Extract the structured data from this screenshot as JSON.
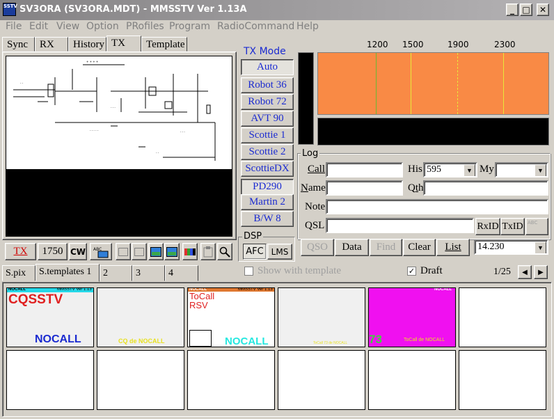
{
  "window": {
    "title": "SV3ORA (SV3ORA.MDT) - MMSSTV Ver 1.13A",
    "icon_text": "SSTV",
    "minimize": "_",
    "maximize": "□",
    "close": "✕"
  },
  "menu": [
    "File",
    "Edit",
    "View",
    "Option",
    "PRofiles",
    "Program",
    "RadioCommand",
    "Help"
  ],
  "tabs": [
    "Sync",
    "RX",
    "History",
    "TX",
    "Template"
  ],
  "active_tab": "TX",
  "tx_mode": {
    "label": "TX Mode",
    "modes": [
      "Auto",
      "Robot 36",
      "Robot 72",
      "AVT 90",
      "Scottie 1",
      "Scottie 2",
      "ScottieDX",
      "PD290",
      "Martin 2",
      "B/W 8"
    ],
    "selected": [
      "Auto",
      "PD290"
    ]
  },
  "spectrum": {
    "freq_labels": [
      "1200",
      "1500",
      "1900",
      "2300"
    ],
    "colors": {
      "background": "#f98a45",
      "sync": "#6bb834",
      "marker": "#e8e83a"
    }
  },
  "log": {
    "title": "Log",
    "call_label": "Call",
    "call_value": "",
    "his_label": "His",
    "his_value": "595",
    "my_label": "My",
    "my_value": "",
    "name_label": "Name",
    "name_value": "",
    "qth_label": "Qth",
    "qth_value": "",
    "note_label": "Note",
    "note_value": "",
    "qsl_label": "QSL",
    "qsl_value": "",
    "rxid": "RxID",
    "txid": "TxID",
    "buttons": [
      "QSO",
      "Data",
      "Find",
      "Clear",
      "List"
    ],
    "freq": "14.230"
  },
  "dsp": {
    "title": "DSP",
    "afc": "AFC",
    "lms": "LMS"
  },
  "toolbar": {
    "tx": "TX",
    "tone": "1750",
    "cw": "CW",
    "abc": "ABC"
  },
  "template_bar": {
    "show_with_template": "Show with template",
    "draft": "Draft",
    "draft_checked": true,
    "page": "1/25"
  },
  "bottom_tabs": [
    "S.pix",
    "S.templates 1",
    "2",
    "3",
    "4"
  ],
  "active_bottom_tab": "S.templates 1",
  "thumbs": {
    "t1_header": "NOCALL",
    "t1_header2": "MMSSTV Ver 1.13",
    "t1_big": "CQSSTV",
    "t1_call": "NOCALL",
    "t2_text": "CQ de NOCALL",
    "t3_header": "NOCALL",
    "t3_header2": "MMSSTV Ver 1.13",
    "t3_line1": "ToCall",
    "t3_line2": "RSV",
    "t3_call": "NOCALL",
    "t4_text": "ToCall 73 de NOCALL",
    "t5_header": "NOCALL",
    "t5_big": "73",
    "t5_text": "ToCall de NOCALL"
  }
}
